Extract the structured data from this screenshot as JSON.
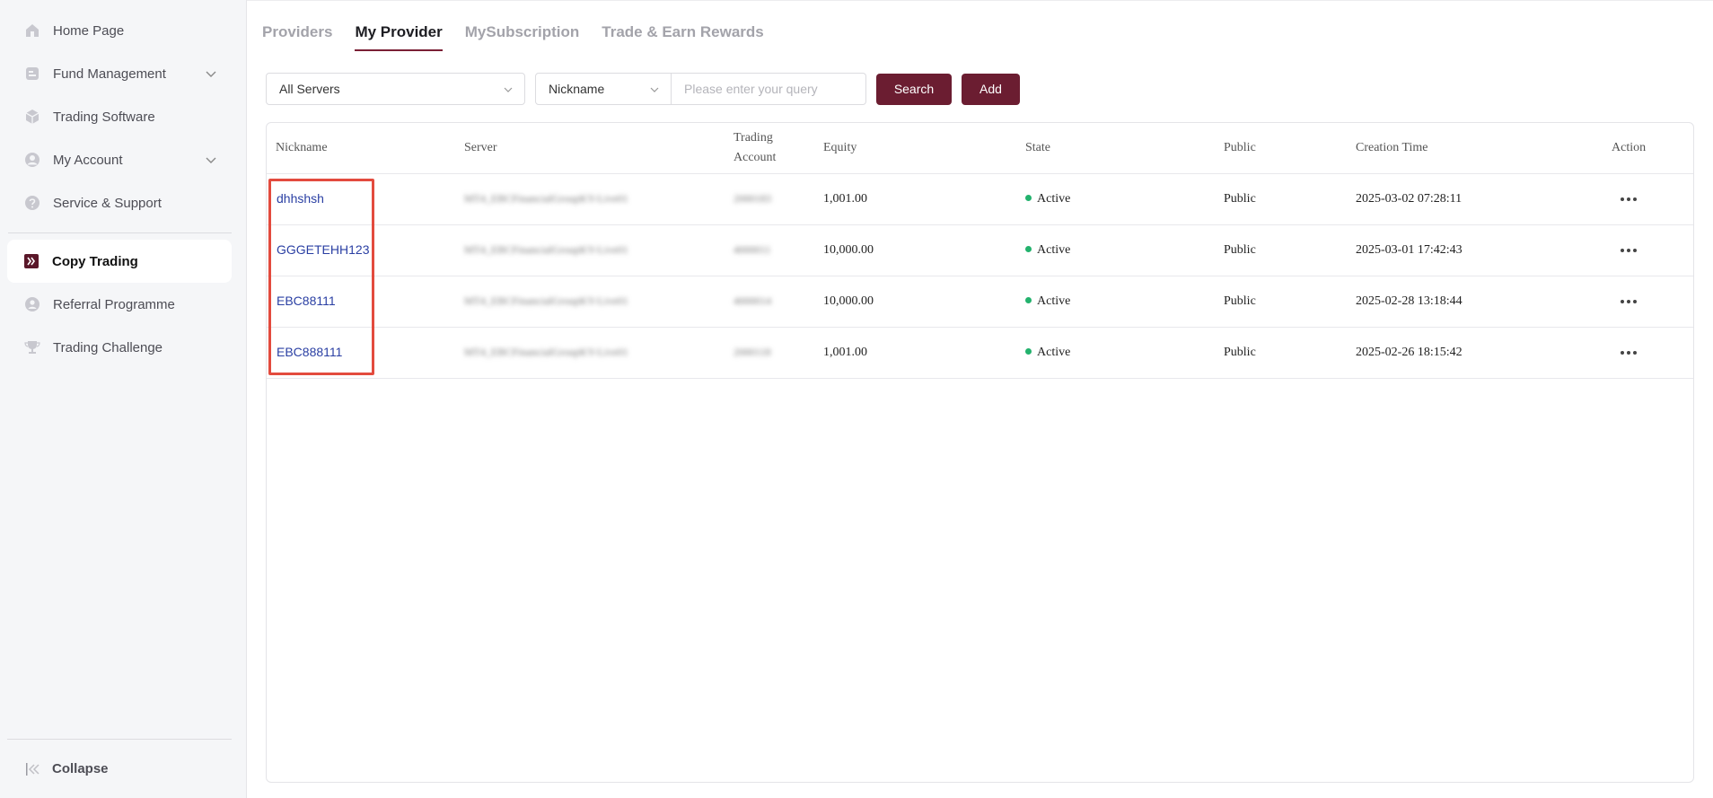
{
  "sidebar": {
    "items": [
      {
        "label": "Home Page",
        "icon": "home-icon"
      },
      {
        "label": "Fund Management",
        "icon": "fund-icon",
        "expandable": true
      },
      {
        "label": "Trading Software",
        "icon": "cube-icon"
      },
      {
        "label": "My Account",
        "icon": "user-icon",
        "expandable": true
      },
      {
        "label": "Service & Support",
        "icon": "help-icon"
      }
    ],
    "items2": [
      {
        "label": "Copy Trading",
        "icon": "copy-trading-icon",
        "active": true
      },
      {
        "label": "Referral Programme",
        "icon": "referral-icon"
      },
      {
        "label": "Trading Challenge",
        "icon": "trophy-icon"
      }
    ],
    "collapse_label": "Collapse"
  },
  "tabs": [
    {
      "label": "Providers"
    },
    {
      "label": "My Provider",
      "active": true
    },
    {
      "label": "MySubscription"
    },
    {
      "label": "Trade & Earn Rewards"
    }
  ],
  "toolbar": {
    "server_select": "All Servers",
    "field_select": "Nickname",
    "query_placeholder": "Please enter your query",
    "search_label": "Search",
    "add_label": "Add"
  },
  "table": {
    "headers": {
      "nickname": "Nickname",
      "server": "Server",
      "account_line1": "Trading",
      "account_line2": "Account",
      "equity": "Equity",
      "state": "State",
      "public": "Public",
      "time": "Creation Time",
      "action": "Action"
    },
    "rows": [
      {
        "nickname": "dhhshsh",
        "server": "MT4_EBCFinancialGroupKY-Live01",
        "account": "2000183",
        "equity": "1,001.00",
        "state": "Active",
        "public": "Public",
        "time": "2025-03-02 07:28:11"
      },
      {
        "nickname": "GGGETEHH123",
        "server": "MT4_EBCFinancialGroupKY-Live01",
        "account": "4000011",
        "equity": "10,000.00",
        "state": "Active",
        "public": "Public",
        "time": "2025-03-01 17:42:43"
      },
      {
        "nickname": "EBC88111",
        "server": "MT4_EBCFinancialGroupKY-Live01",
        "account": "4000014",
        "equity": "10,000.00",
        "state": "Active",
        "public": "Public",
        "time": "2025-02-28 13:18:44"
      },
      {
        "nickname": "EBC888111",
        "server": "MT4_EBCFinancialGroupKY-Live01",
        "account": "2000118",
        "equity": "1,001.00",
        "state": "Active",
        "public": "Public",
        "time": "2025-02-26 18:15:42"
      }
    ]
  },
  "colors": {
    "accent": "#6b1d31",
    "link": "#2a3fa3",
    "active_dot": "#23b26d",
    "highlight": "#e34b3e"
  }
}
